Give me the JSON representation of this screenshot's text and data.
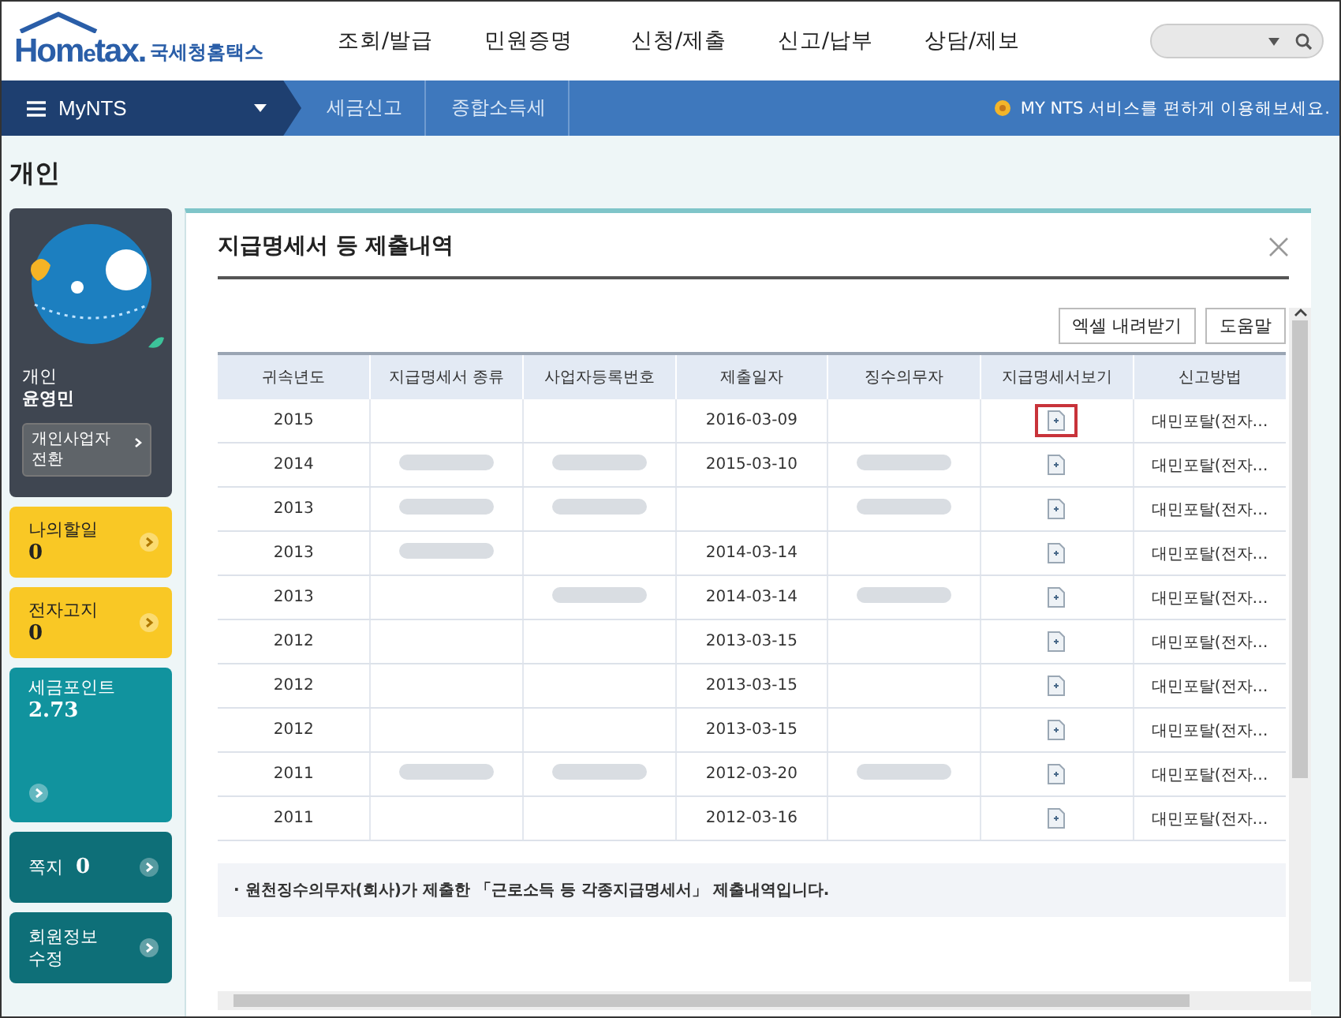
{
  "header": {
    "brand_home": "Hom",
    "brand_e": "e",
    "brand_tax": "tax.",
    "brand_name": "국세청홈택스",
    "menu": [
      "조회/발급",
      "민원증명",
      "신청/제출",
      "신고/납부",
      "상담/제보"
    ]
  },
  "nav": {
    "home": "MyNTS",
    "breadcrumbs": [
      "세금신고",
      "종합소득세"
    ],
    "notice": "MY NTS 서비스를 편하게 이용해보세요."
  },
  "page_title": "개인",
  "sidebar": {
    "user_type": "개인",
    "user_name": "윤영민",
    "switch_button": "개인사업자 전환",
    "cards": [
      {
        "label": "나의할일",
        "value": "0",
        "color": "#f9c825",
        "kind": "small"
      },
      {
        "label": "전자고지",
        "value": "0",
        "color": "#f9c825",
        "kind": "small"
      },
      {
        "label": "세금포인트",
        "value": "2.73",
        "color": "#11939e",
        "kind": "tall"
      },
      {
        "label": "쪽지",
        "value": "0",
        "color": "#0e6f78",
        "kind": "inline"
      },
      {
        "label": "회원정보 수정",
        "color": "#0e6f78",
        "kind": "small"
      }
    ]
  },
  "modal": {
    "title": "지급명세서 등 제출내역",
    "buttons": [
      "엑셀 내려받기",
      "도움말"
    ],
    "columns": [
      "귀속년도",
      "지급명세서 종류",
      "사업자등록번호",
      "제출일자",
      "징수의무자",
      "지급명세서보기",
      "신고방법"
    ],
    "rows": [
      {
        "year": "2015",
        "date": "2016-03-09",
        "method": "대민포탈(전자…",
        "redacted": [
          false,
          false,
          false
        ],
        "selected": true
      },
      {
        "year": "2014",
        "date": "2015-03-10",
        "method": "대민포탈(전자…",
        "redacted": [
          true,
          true,
          true
        ],
        "selected": false
      },
      {
        "year": "2013",
        "date": "",
        "method": "대민포탈(전자…",
        "redacted": [
          true,
          true,
          true
        ],
        "selected": false
      },
      {
        "year": "2013",
        "date": "2014-03-14",
        "method": "대민포탈(전자…",
        "redacted": [
          true,
          false,
          false
        ],
        "selected": false
      },
      {
        "year": "2013",
        "date": "2014-03-14",
        "method": "대민포탈(전자…",
        "redacted": [
          false,
          true,
          true
        ],
        "selected": false
      },
      {
        "year": "2012",
        "date": "2013-03-15",
        "method": "대민포탈(전자…",
        "redacted": [
          false,
          false,
          false
        ],
        "selected": false
      },
      {
        "year": "2012",
        "date": "2013-03-15",
        "method": "대민포탈(전자…",
        "redacted": [
          false,
          false,
          false
        ],
        "selected": false
      },
      {
        "year": "2012",
        "date": "2013-03-15",
        "method": "대민포탈(전자…",
        "redacted": [
          false,
          false,
          false
        ],
        "selected": false
      },
      {
        "year": "2011",
        "date": "2012-03-20",
        "method": "대민포탈(전자…",
        "redacted": [
          true,
          true,
          true
        ],
        "selected": false
      },
      {
        "year": "2011",
        "date": "2012-03-16",
        "method": "대민포탈(전자…",
        "redacted": [
          false,
          false,
          false
        ],
        "selected": false
      }
    ],
    "note": "· 원천징수의무자(회사)가 제출한 「근로소득 등 각종지급명세서」 제출내역입니다."
  }
}
